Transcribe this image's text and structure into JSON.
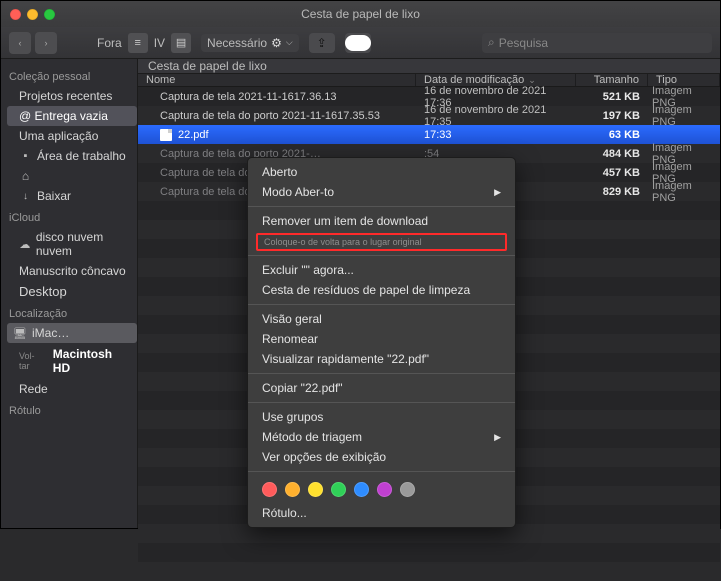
{
  "window_title": "Cesta de papel de lixo",
  "toolbar": {
    "back": "‹",
    "fwd": "›",
    "view_label_left": "Fora",
    "view_label_right": "IV",
    "dropdown_label": "Necessário",
    "search_placeholder": "Pesquisa"
  },
  "sidebar": {
    "sec_collection": "Coleção pessoal",
    "projects": "Projetos recentes",
    "delivery": "@ Entrega vazia",
    "app": "Uma aplicação",
    "desktop_area": "Área de trabalho",
    "home": " ",
    "download": "Baixar",
    "sec_icloud": "iCloud",
    "icloud_disk": "disco nuvem nuvem",
    "manuscript": "Manuscrito côncavo",
    "desktop": "Desktop",
    "sec_location": "Localização",
    "mac": "iMac…",
    "mac_hd": "Macintosh HD",
    "back": "Vol-tar",
    "network": "Rede",
    "sec_label": "Rótulo"
  },
  "pathbar": "Cesta de papel de lixo",
  "columns": {
    "name": "Nome",
    "date": "Data de modificação",
    "size": "Tamanho",
    "kind": "Tipo"
  },
  "rows": [
    {
      "name": "Captura de tela 2021-11-1617.36.13",
      "date": "16 de novembro de 2021 17:36",
      "size": "521 KB",
      "kind": "Imagem PNG",
      "sel": false,
      "dim": false
    },
    {
      "name": "Captura de tela do porto 2021-11-1617.35.53",
      "date": "16 de novembro de 2021 17:35",
      "size": "197 KB",
      "kind": "Imagem PNG",
      "sel": false,
      "dim": false
    },
    {
      "name": "22.pdf",
      "date": "",
      "size": "63 KB",
      "kind": "",
      "sel": true,
      "dim": false,
      "icon": "pdf",
      "timehint": "17:33"
    },
    {
      "name": "Captura de tela do porto 2021-…",
      "date": "",
      "size": "484 KB",
      "kind": "Imagem PNG",
      "sel": false,
      "dim": true,
      "timehint": ":54"
    },
    {
      "name": "Captura de tela do porto 2021-…",
      "date": "",
      "size": "457 KB",
      "kind": "Imagem PNG",
      "sel": false,
      "dim": true,
      "timehint": ":29"
    },
    {
      "name": "Captura de tela do porto 2021-…",
      "date": "",
      "size": "829 KB",
      "kind": "Imagem PNG",
      "sel": false,
      "dim": true,
      "timehint": "3 28"
    }
  ],
  "menu": {
    "open": "Aberto",
    "open_with": "Modo Aber-to",
    "remove_dl": "Remover um item de download",
    "putback": "Coloque-o de volta para o lugar original",
    "delete_now": "Excluir \"\" agora...",
    "empty_trash": "Cesta de resíduos de papel de limpeza",
    "overview": "Visão geral",
    "rename": "Renomear",
    "quicklook": "Visualizar rapidamente \"22.pdf\"",
    "copy": "Copiar \"22.pdf\"",
    "use_groups": "Use grupos",
    "sort": "Método de triagem",
    "show_opts": "Ver opções de exibição",
    "label": "Rótulo..."
  }
}
